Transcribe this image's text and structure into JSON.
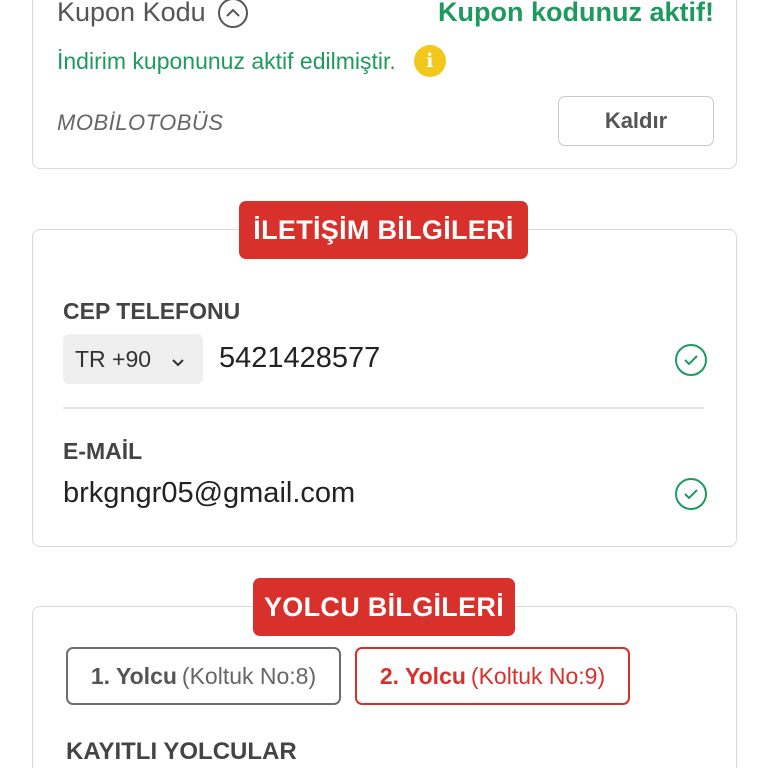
{
  "coupon": {
    "title": "Kupon Kodu",
    "status": "Kupon kodunuz aktif!",
    "message": "İndirim kuponunuz aktif edilmiştir.",
    "code": "MOBİLOTOBÜS",
    "remove_label": "Kaldır"
  },
  "contact": {
    "section_title": "İLETİŞİM BİLGİLERİ",
    "phone_label": "CEP TELEFONU",
    "country_code": "TR +90",
    "phone_value": "5421428577",
    "email_label": "E-MAİL",
    "email_value": "brkgngr05@gmail.com"
  },
  "passengers": {
    "section_title": "YOLCU BİLGİLERİ",
    "tabs": [
      {
        "name": "1. Yolcu",
        "seat": "(Koltuk No:8)",
        "active": false
      },
      {
        "name": "2. Yolcu",
        "seat": "(Koltuk No:9)",
        "active": true
      }
    ],
    "saved_label": "KAYITLI YOLCULAR"
  },
  "colors": {
    "accent": "#d8312b",
    "success": "#1e9a5e",
    "info": "#f2c81c"
  }
}
